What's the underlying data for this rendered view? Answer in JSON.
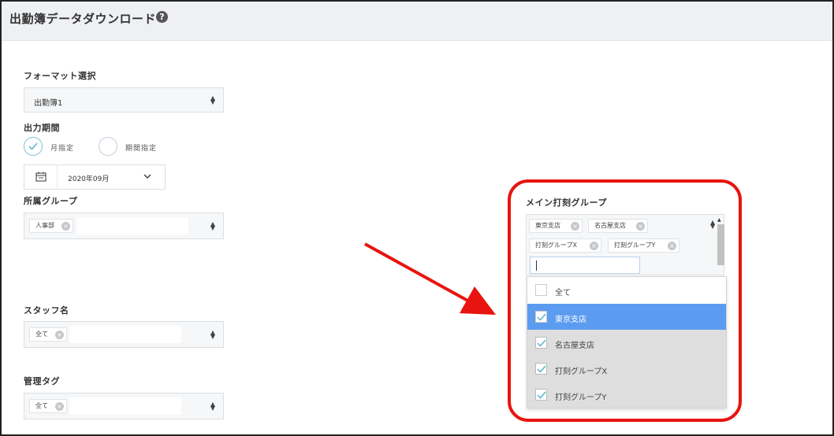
{
  "header": {
    "title": "出勤簿データダウンロード",
    "help": "?"
  },
  "format": {
    "label": "フォーマット選択",
    "value": "出勤簿1"
  },
  "period": {
    "label": "出力期間",
    "options": [
      {
        "label": "月指定",
        "selected": true
      },
      {
        "label": "期間指定",
        "selected": false
      }
    ],
    "month": "2020年09月"
  },
  "group": {
    "label": "所属グループ",
    "tags": [
      "人事部"
    ]
  },
  "staff": {
    "label": "スタッフ名",
    "tags": [
      "全て"
    ]
  },
  "mgmt_tag": {
    "label": "管理タグ",
    "tags": [
      "全て"
    ]
  },
  "main_group": {
    "label": "メイン打刻グループ",
    "tags": [
      "東京支店",
      "名古屋支店",
      "打刻グループX",
      "打刻グループY"
    ],
    "search_placeholder": "",
    "options": [
      {
        "label": "全て",
        "checked": false,
        "highlighted": false
      },
      {
        "label": "東京支店",
        "checked": true,
        "highlighted": true
      },
      {
        "label": "名古屋支店",
        "checked": true,
        "highlighted": false
      },
      {
        "label": "打刻グループX",
        "checked": true,
        "highlighted": false
      },
      {
        "label": "打刻グループY",
        "checked": true,
        "highlighted": false
      }
    ]
  },
  "icons": {
    "help": "question-circle-icon",
    "calendar": "calendar-icon",
    "chevron": "chevron-down-icon",
    "remove": "close-circle-icon",
    "check": "check-icon",
    "arrow": "red-arrow-annotation"
  },
  "colors": {
    "accent": "#5b9cf1",
    "check": "#5cb4cf",
    "annotation": "#e8140f",
    "header_bg": "#eef0f3"
  }
}
